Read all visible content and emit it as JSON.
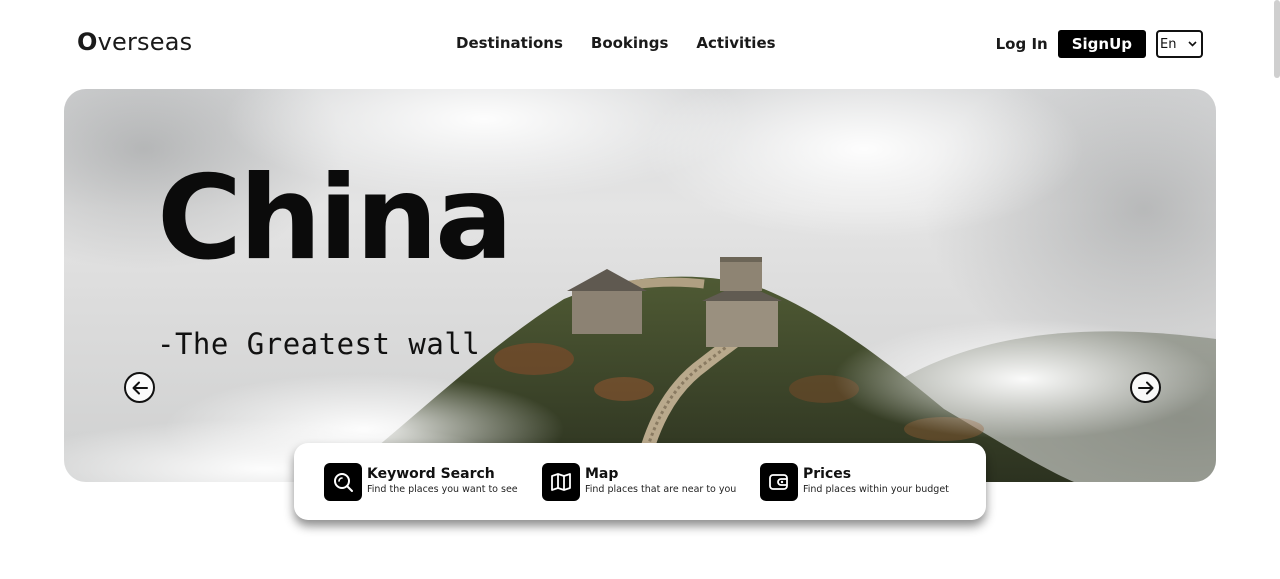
{
  "brand": {
    "first_letter": "O",
    "rest": "verseas"
  },
  "nav": {
    "items": [
      "Destinations",
      "Bookings",
      "Activities"
    ]
  },
  "auth": {
    "login_label": "Log In",
    "signup_label": "SignUp"
  },
  "language": {
    "selected": "En"
  },
  "hero": {
    "title": "China",
    "subtitle": "-The Greatest wall",
    "prev_icon": "arrow-left-icon",
    "next_icon": "arrow-right-icon"
  },
  "features": [
    {
      "icon": "search-icon",
      "title": "Keyword Search",
      "description": "Find the places you want to see"
    },
    {
      "icon": "map-icon",
      "title": "Map",
      "description": "Find places that are near to you"
    },
    {
      "icon": "wallet-icon",
      "title": "Prices",
      "description": "Find places within your budget"
    }
  ],
  "colors": {
    "primary": "#000000",
    "background": "#ffffff",
    "text": "#111111"
  }
}
